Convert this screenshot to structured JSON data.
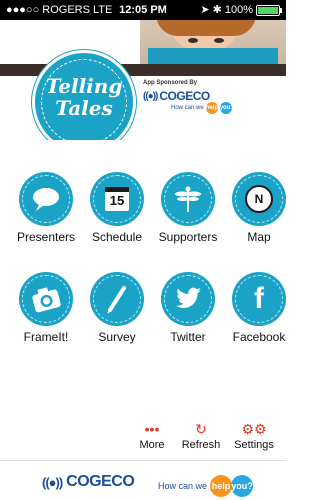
{
  "status_bar": {
    "carrier": "●●●○○ ROGERS  LTE",
    "time": "12:05 PM",
    "battery_text": "100%",
    "battery_level": 1.0
  },
  "header": {
    "logo_text": "Telling Tales",
    "sponsor_label": "App Sponsored By",
    "sponsor_mark": "((●))",
    "sponsor_name": "COGECO",
    "tagline": "How can we",
    "tag_help": "help",
    "tag_you": "you?"
  },
  "tiles": [
    {
      "label": "Presenters",
      "icon": "speech-bubble-icon"
    },
    {
      "label": "Schedule",
      "icon": "calendar-icon",
      "calendar_day": "15"
    },
    {
      "label": "Supporters",
      "icon": "dragonfly-icon"
    },
    {
      "label": "Map",
      "icon": "compass-icon",
      "compass_letter": "N"
    },
    {
      "label": "FrameIt!",
      "icon": "camera-icon"
    },
    {
      "label": "Survey",
      "icon": "pen-icon"
    },
    {
      "label": "Twitter",
      "icon": "twitter-bird-icon"
    },
    {
      "label": "Facebook",
      "icon": "facebook-icon",
      "icon_letter": "f"
    }
  ],
  "toolbar": {
    "more_label": "More",
    "refresh_label": "Refresh",
    "settings_label": "Settings",
    "accent": "#e8321e"
  },
  "footer": {
    "mark": "((●))",
    "name": "COGECO",
    "tagline": "How can we",
    "help": "help",
    "you": "you?"
  },
  "colors": {
    "tile_blue": "#1aa3c6",
    "brand_blue": "#1b4e9b",
    "help_orange": "#f7941d"
  }
}
